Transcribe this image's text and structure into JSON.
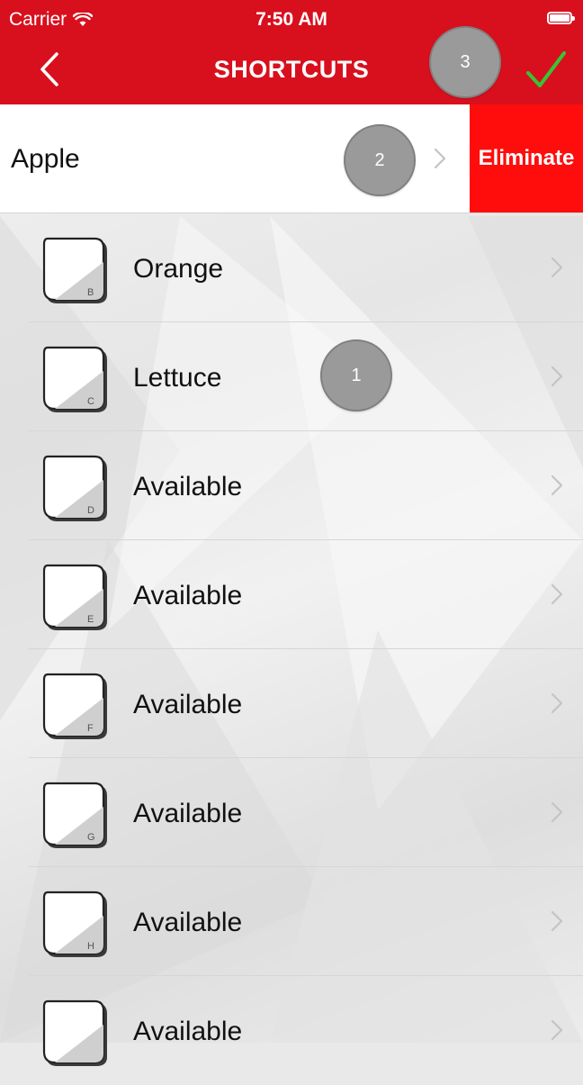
{
  "status_bar": {
    "carrier": "Carrier",
    "time": "7:50 AM"
  },
  "nav": {
    "title": "SHORTCUTS",
    "back_icon": "chevron-left-icon",
    "confirm_icon": "checkmark-icon"
  },
  "swiped_row": {
    "label": "Apple",
    "action_label": "Eliminate"
  },
  "markers": [
    "1",
    "2",
    "3"
  ],
  "rows": [
    {
      "key": "B",
      "label": "Orange"
    },
    {
      "key": "C",
      "label": "Lettuce"
    },
    {
      "key": "D",
      "label": "Available"
    },
    {
      "key": "E",
      "label": "Available"
    },
    {
      "key": "F",
      "label": "Available"
    },
    {
      "key": "G",
      "label": "Available"
    },
    {
      "key": "H",
      "label": "Available"
    },
    {
      "key": "",
      "label": "Available"
    }
  ],
  "colors": {
    "nav_red": "#d8101e",
    "eliminate_red": "#ff0d0d",
    "check_green": "#35c535",
    "marker_gray": "#9a9a9a"
  }
}
